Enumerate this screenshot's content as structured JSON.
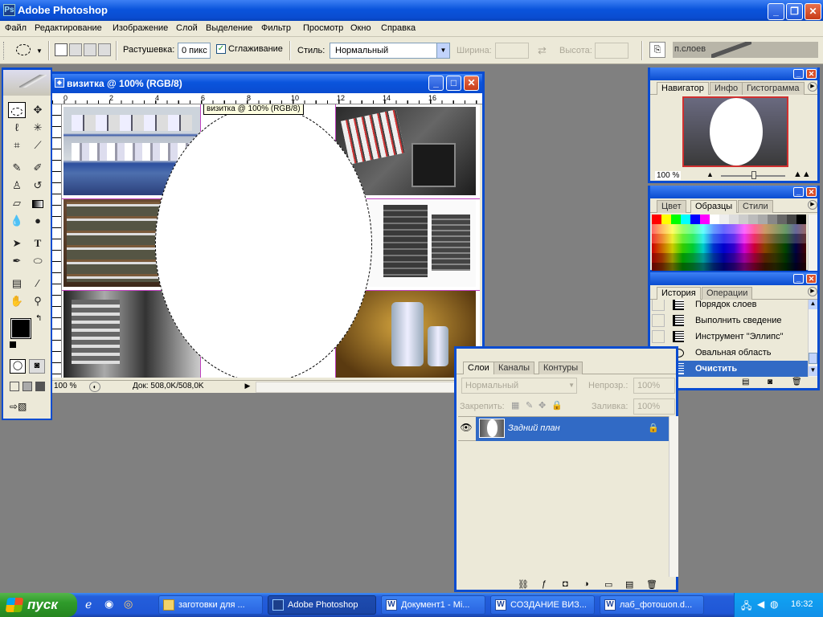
{
  "app": {
    "title": "Adobe Photoshop"
  },
  "menu": [
    "Файл",
    "Редактирование",
    "Изображение",
    "Слой",
    "Выделение",
    "Фильтр",
    "Просмотр",
    "Окно",
    "Справка"
  ],
  "options": {
    "feather_label": "Растушевка:",
    "feather_value": "0 пикс",
    "antialias_label": "Сглаживание",
    "antialias_checked": true,
    "style_label": "Стиль:",
    "style_value": "Нормальный",
    "width_label": "Ширина:",
    "height_label": "Высота:",
    "palette_well_label": "п.слоев"
  },
  "document": {
    "title": "визитка @ 100% (RGB/8)",
    "tooltip": "визитка @ 100% (RGB/8)",
    "zoom": "100 %",
    "doc_size": "Док: 508,0K/508,0K",
    "ruler_labels": [
      "0",
      "2",
      "4",
      "6",
      "8",
      "10",
      "12",
      "14",
      "16"
    ]
  },
  "navigator": {
    "tabs": [
      "Навигатор",
      "Инфо",
      "Гистограмма"
    ],
    "zoom": "100 %"
  },
  "swatches": {
    "tabs": [
      "Цвет",
      "Образцы",
      "Стили"
    ]
  },
  "history": {
    "tabs": [
      "История",
      "Операции"
    ],
    "items": [
      {
        "label": "Порядок слоев",
        "icon": "history-state-icon"
      },
      {
        "label": "Выполнить сведение",
        "icon": "history-state-icon"
      },
      {
        "label": "Инструмент \"Эллипс\"",
        "icon": "history-state-icon"
      },
      {
        "label": "Овальная область",
        "icon": "ellipse-icon"
      },
      {
        "label": "Очистить",
        "icon": "history-state-icon",
        "selected": true
      }
    ]
  },
  "layers": {
    "tabs": [
      "Слои",
      "Каналы",
      "Контуры"
    ],
    "blend_mode": "Нормальный",
    "opacity_label": "Непрозр.:",
    "opacity_value": "100%",
    "lock_label": "Закрепить:",
    "fill_label": "Заливка:",
    "fill_value": "100%",
    "layer_name": "Задний план"
  },
  "taskbar": {
    "start_label": "пуск",
    "buttons": [
      {
        "label": "заготовки для ...",
        "icon": "folder-icon",
        "active": false
      },
      {
        "label": "Adobe Photoshop",
        "icon": "photoshop-icon",
        "active": true
      },
      {
        "label": "Документ1 - Mi...",
        "icon": "word-icon",
        "active": false
      },
      {
        "label": "СОЗДАНИЕ ВИЗ...",
        "icon": "word-icon",
        "active": false
      },
      {
        "label": "лаб_фотошоп.d...",
        "icon": "word-icon",
        "active": false
      }
    ],
    "clock": "16:32"
  },
  "colors": {
    "xp_blue": "#0a4cd0",
    "selection_blue": "#316ac5",
    "start_green": "#2f9b2b",
    "guide_magenta": "#c040c0",
    "foreground": "#000000",
    "background": "#ffffff"
  }
}
